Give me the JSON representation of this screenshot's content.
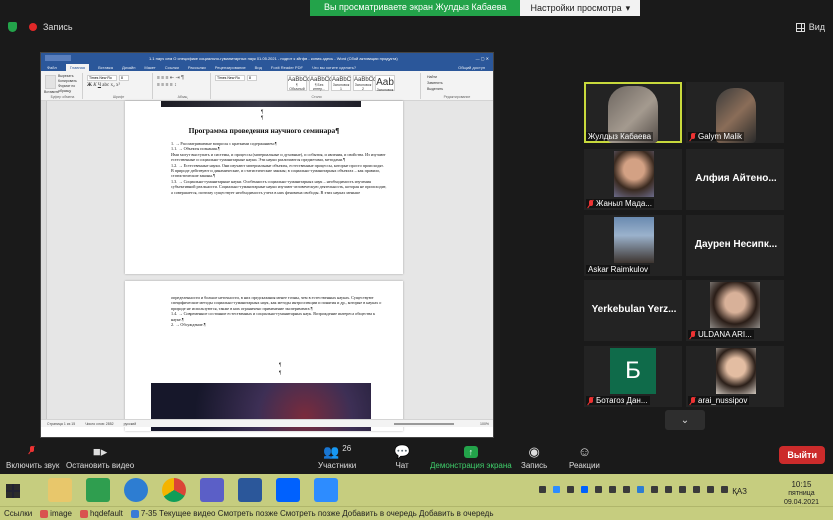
{
  "zoom_top": {
    "recording_label": "Запись",
    "banner_text": "Вы просматриваете экран Жулдыз Кабаева",
    "view_options_label": "Настройки просмотра",
    "view_label": "Вид"
  },
  "word": {
    "title": "1.1 науч сем О специфике социально-гуманитарных наук 01.05.2021 - подгот к зйгфв - копия-здесь - Word (Сбой активации продукта)",
    "tabs": [
      "Файл",
      "Главная",
      "Вставка",
      "Дизайн",
      "Макет",
      "Ссылки",
      "Рассылки",
      "Рецензирование",
      "Вид",
      "Foxit Reader PDF",
      "Что вы хотите сделать?"
    ],
    "share_label": "Общий доступ",
    "font_name": "Times New Ro",
    "font_size": "8",
    "font_name2": "Times New Ro",
    "font_size2": "8",
    "paste_label": "Вставить",
    "clipboard_items": [
      "Вырезать",
      "Копировать",
      "Формат по образцу"
    ],
    "group_labels": [
      "Буфер обмена",
      "Шрифт",
      "Абзац",
      "Стили",
      "Редактирование"
    ],
    "styles": [
      {
        "sample": "AaBbCcDd",
        "name": "¶ Обычный"
      },
      {
        "sample": "AaBbCcDd",
        "name": "¶ Без интер..."
      },
      {
        "sample": "AaBbC",
        "name": "Заголовок 1"
      },
      {
        "sample": "AaBbCc",
        "name": "Заголовок 2"
      },
      {
        "sample": "Aab",
        "name": "Заголовок"
      }
    ],
    "editing": [
      "Найти",
      "Заменить",
      "Выделить"
    ],
    "page_title": "Программа проведения научного семинара¶",
    "page1_text": [
      "1.  →  Рассматриваемые вопросы с краткими содержанием:¶",
      "1.1.  →  Объекты познания.¶",
      "Ими могут выступать и системы, и процессы (материальные и духовные), и события, и явления, и свойства. Из изучают естественные и социально-гуманитарные науки. Эти науки различаются предметами, методами.¶",
      "1.2.  →  Естественные науки. Они изучают материальные объекты, естественные процессы, которые просто происходят. В природе действуют и динамические, и статистические законы; в социально-гуманитарных объектах – как правило, статистические законы.¶",
      "1.3.  →  Социально-гуманитарные науки. Особенность социально-гуманитарных наук – необходимость изучения субъективной реальности. Социально-гуманитарные науки изучают человеческую деятельность, которая не происходит, а совершается, поэтому существует необходимость учета в них феномена свободы. В этих науках меньше"
    ],
    "page2_text": [
      "определенности и больше неточности, в них предсказания менее точны, чем в естественных науках. Существуют специфические методы социально-гуманитарных наук, как методы интроспекции и понятия и др., которые в науках о природе не используются, также в них ограничено применение эксперимента.¶",
      "1.4.  →  Современное состояние естественных и социально-гуманитарных наук. Возрождение интереса общества к науке.¶",
      "2.  →  Обсуждение.¶"
    ],
    "status": [
      "Страница 1 из 15",
      "Число слов: 2852",
      "русский"
    ],
    "zoom_percent": "100%"
  },
  "participants": [
    {
      "name": "Жулдыз Кабаева",
      "mic": "on",
      "kind": "video",
      "speaking": true
    },
    {
      "name": "Galym Malik",
      "mic": "off",
      "kind": "video"
    },
    {
      "name": "Жаныл Мада...",
      "mic": "off",
      "kind": "photo"
    },
    {
      "name": "Алфия Айтено...",
      "mic": "none",
      "kind": "name"
    },
    {
      "name": "Askar Raimkulov",
      "mic": "on",
      "kind": "photo"
    },
    {
      "name": "Даурен Несипк...",
      "mic": "none",
      "kind": "name"
    },
    {
      "name": "Yerkebulan Yerz...",
      "mic": "none",
      "kind": "name"
    },
    {
      "name": "ULDANA ARI...",
      "mic": "off",
      "kind": "photo"
    },
    {
      "name": "Ботагоз Дан...",
      "mic": "off",
      "kind": "letter",
      "letter": "Б"
    },
    {
      "name": "arai_nussipov",
      "mic": "off",
      "kind": "photo"
    }
  ],
  "toolbar": {
    "unmute": "Включить звук",
    "start_video": "Остановить видео",
    "participants": "Участники",
    "participants_count": "26",
    "chat": "Чат",
    "share_screen": "Демонстрация экрана",
    "record": "Запись",
    "reactions": "Реакции",
    "leave": "Выйти"
  },
  "taskbar": {
    "language": "ҚАЗ",
    "time": "10:15",
    "weekday": "пятница",
    "date": "09.04.2021"
  },
  "links_bar": {
    "links_label": "Ссылки",
    "items": [
      "image",
      "hqdefault",
      "7-35 Текущее видео Смотреть позже Смотреть позже Добавить в очередь Добавить в очередь"
    ]
  },
  "colors": {
    "zoom_green": "#23a34a",
    "word_blue": "#2b579a",
    "leave_red": "#cc2b2b",
    "speaker_outline": "#c8d93c",
    "taskbar": "#c6cd7f"
  }
}
